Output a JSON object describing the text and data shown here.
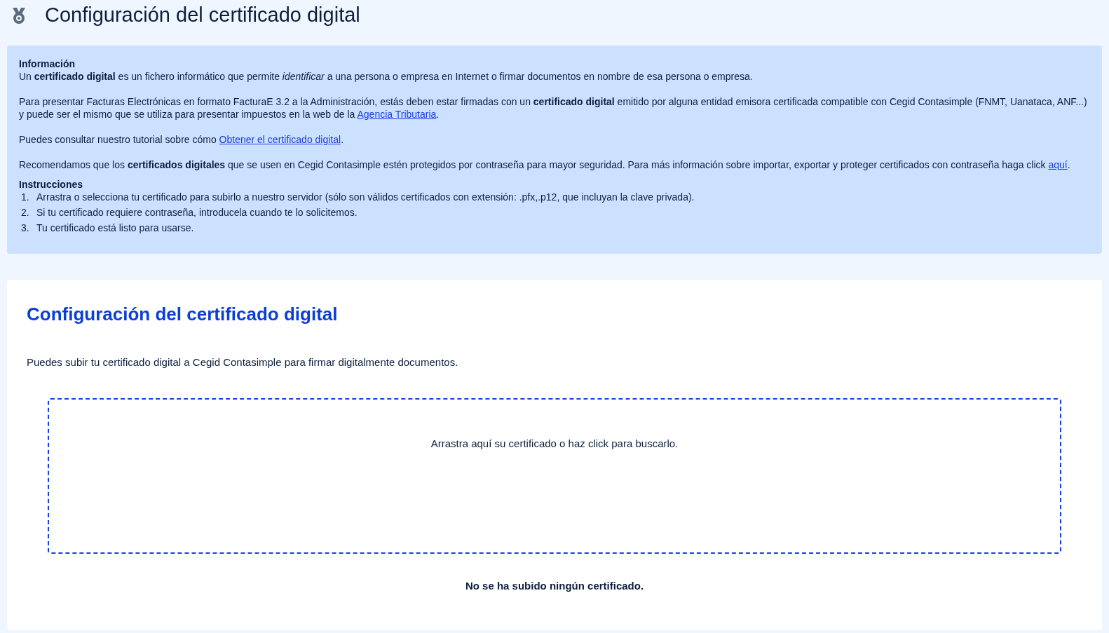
{
  "header": {
    "title": "Configuración del certificado digital"
  },
  "info": {
    "title": "Información",
    "paragraphs": [
      {
        "before": "Un **certificado digital** es un fichero informático que permite *identificar* a una persona o empresa en Internet o firmar documentos en nombre de esa persona o empresa."
      },
      {
        "before": "Para presentar Facturas Electrónicas en formato FacturaE 3.2 a la Administración, estás deben estar firmadas con un **certificado digital** emitido por alguna entidad emisora certificada compatible con Cegid Contasimple (FNMT, Uanataca, ANF...) y puede ser el mismo que se utiliza para presentar impuestos en la web de la ",
        "link": "Agencia Tributaria",
        "after": "."
      },
      {
        "before": "Puedes consultar nuestro tutorial sobre cómo ",
        "link": "Obtener el certificado digital",
        "after": "."
      },
      {
        "before": "Recomendamos que los **certificados digitales** que se usen en Cegid Contasimple estén protegidos por contraseña para mayor seguridad. Para más información sobre importar, exportar y proteger certificados con contraseña haga click ",
        "link": "aquí",
        "after": "."
      }
    ],
    "instructions_title": "Instrucciones",
    "steps": [
      {
        "number": "1.",
        "text": "Arrastra o selecciona tu certificado para subirlo a nuestro servidor (sólo son válidos certificados con extensión: .pfx,.p12, que incluyan la clave privada)."
      },
      {
        "number": "2.",
        "text": "Si tu certificado requiere contraseña, introducela cuando te lo solicitemos."
      },
      {
        "number": "3.",
        "text": "Tu certificado está listo para usarse."
      }
    ]
  },
  "card": {
    "title": "Configuración del certificado digital",
    "description": "Puedes subir tu certificado digital a Cegid Contasimple para firmar digitalmente documentos.",
    "dropzone": "Arrastra aquí su certificado o haz click para buscarlo.",
    "status": "No se ha subido ningún certificado."
  }
}
